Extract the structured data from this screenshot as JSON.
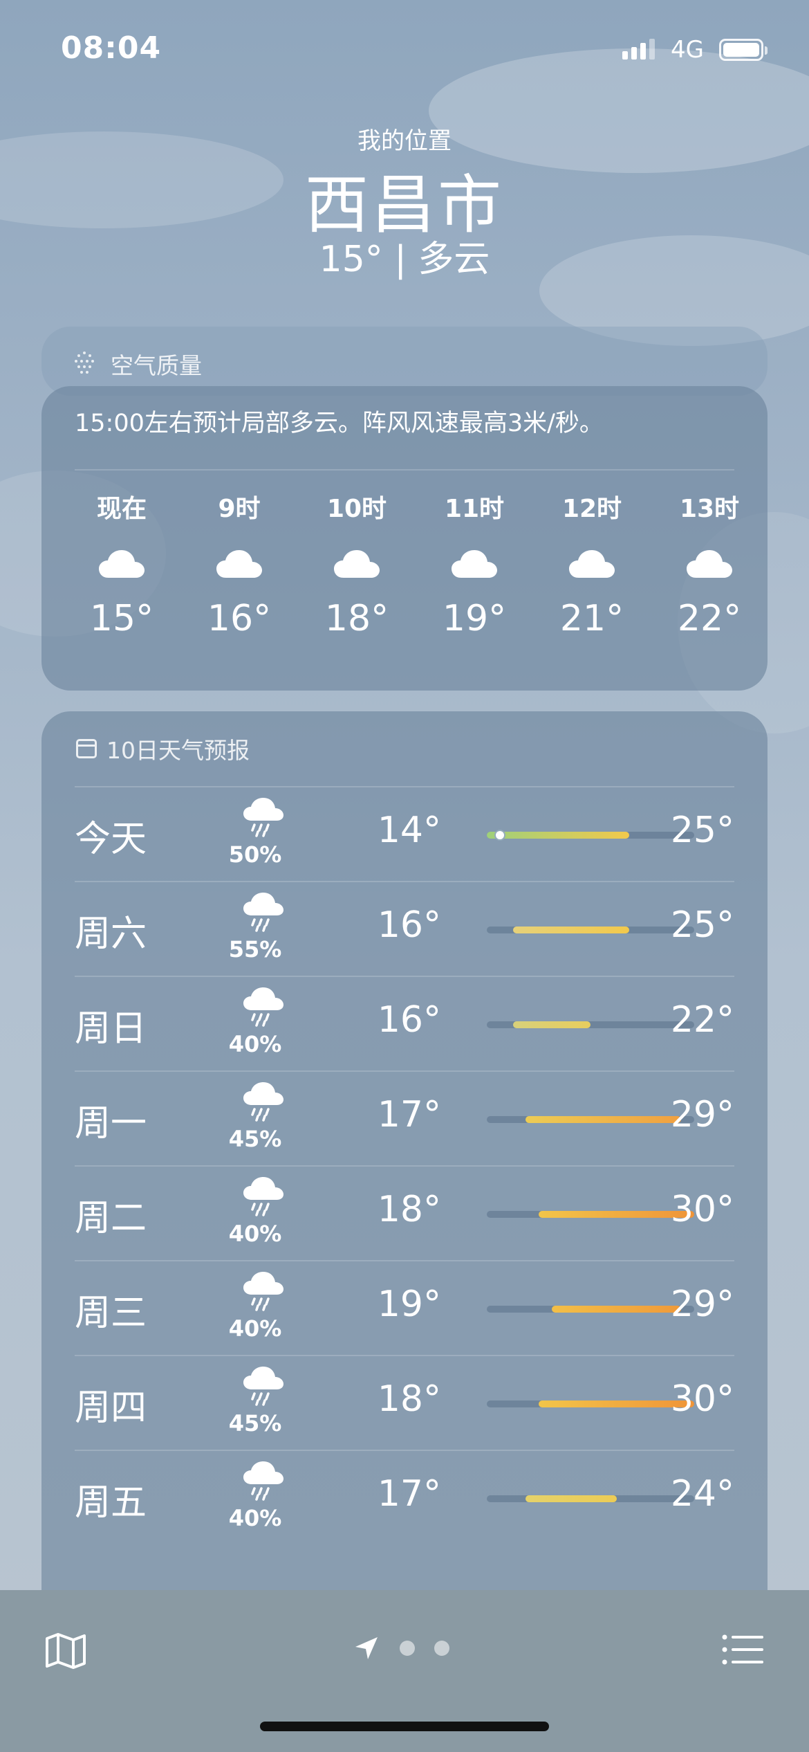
{
  "status_bar": {
    "time": "08:04",
    "network": "4G",
    "icons": [
      "signal-icon",
      "battery-icon"
    ]
  },
  "location": {
    "label": "我的位置",
    "city": "西昌市",
    "summary": "15° | 多云"
  },
  "air_quality": {
    "title": "空气质量",
    "icon": "dots-grid-icon"
  },
  "hourly": {
    "summary": "15:00左右预计局部多云。阵风风速最高3米/秒。",
    "items": [
      {
        "label": "现在",
        "temp": "15°",
        "icon": "cloud-icon"
      },
      {
        "label": "9时",
        "temp": "16°",
        "icon": "cloud-icon"
      },
      {
        "label": "10时",
        "temp": "18°",
        "icon": "cloud-icon"
      },
      {
        "label": "11时",
        "temp": "19°",
        "icon": "cloud-icon"
      },
      {
        "label": "12时",
        "temp": "21°",
        "icon": "cloud-icon"
      },
      {
        "label": "13时",
        "temp": "22°",
        "icon": "cloud-icon"
      }
    ]
  },
  "forecast": {
    "title": "10日天气预报",
    "icon": "calendar-icon",
    "range_min": 14,
    "range_max": 30,
    "current_temp": 15,
    "days": [
      {
        "day": "今天",
        "pop": "50%",
        "low": "14°",
        "high": "25°",
        "lo": 14,
        "hi": 25,
        "icon": "rain-cloud-icon",
        "colors": [
          "#9fd07a",
          "#f2c94c"
        ]
      },
      {
        "day": "周六",
        "pop": "55%",
        "low": "16°",
        "high": "25°",
        "lo": 16,
        "hi": 25,
        "icon": "rain-cloud-icon",
        "colors": [
          "#e6d17a",
          "#f2c94c"
        ]
      },
      {
        "day": "周日",
        "pop": "40%",
        "low": "16°",
        "high": "22°",
        "lo": 16,
        "hi": 22,
        "icon": "rain-cloud-icon",
        "colors": [
          "#d8d07a",
          "#e8cd5e"
        ]
      },
      {
        "day": "周一",
        "pop": "45%",
        "low": "17°",
        "high": "29°",
        "lo": 17,
        "hi": 29,
        "icon": "rain-cloud-icon",
        "colors": [
          "#eccc55",
          "#f0a040"
        ]
      },
      {
        "day": "周二",
        "pop": "40%",
        "low": "18°",
        "high": "30°",
        "lo": 18,
        "hi": 30,
        "icon": "rain-cloud-icon",
        "colors": [
          "#f2c54a",
          "#ef9438"
        ]
      },
      {
        "day": "周三",
        "pop": "40%",
        "low": "19°",
        "high": "29°",
        "lo": 19,
        "hi": 29,
        "icon": "rain-cloud-icon",
        "colors": [
          "#f2bf48",
          "#ef9a3a"
        ]
      },
      {
        "day": "周四",
        "pop": "45%",
        "low": "18°",
        "high": "30°",
        "lo": 18,
        "hi": 30,
        "icon": "rain-cloud-icon",
        "colors": [
          "#f2c54a",
          "#ef9438"
        ]
      },
      {
        "day": "周五",
        "pop": "40%",
        "low": "17°",
        "high": "24°",
        "lo": 17,
        "hi": 24,
        "icon": "rain-cloud-icon",
        "colors": [
          "#e5d26a",
          "#eccc55"
        ]
      }
    ]
  },
  "tab_bar": {
    "icons": [
      "map-icon",
      "location-arrow-icon",
      "page-dot-icon",
      "page-dot-icon",
      "list-icon"
    ]
  }
}
